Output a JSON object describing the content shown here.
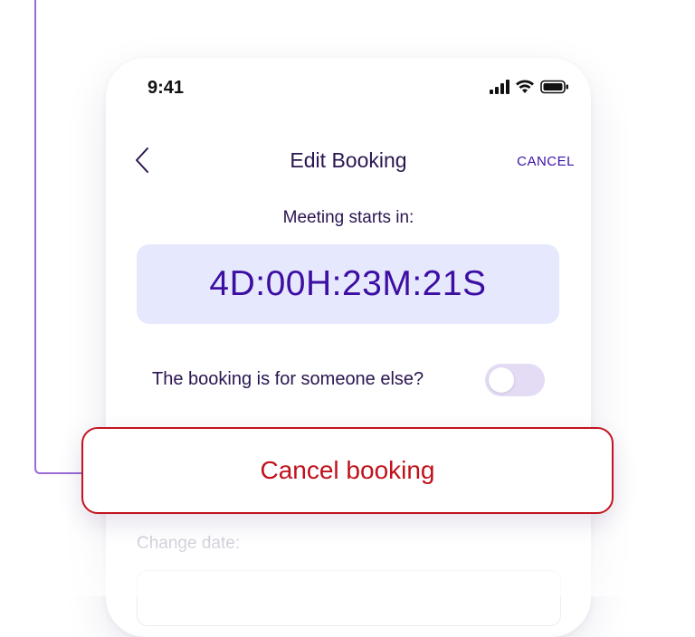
{
  "status_bar": {
    "time": "9:41",
    "icons": [
      "signal-icon",
      "wifi-icon",
      "battery-icon"
    ]
  },
  "nav": {
    "back_icon": "chevron-left-icon",
    "title": "Edit Booking",
    "cancel_label": "CANCEL"
  },
  "countdown": {
    "label": "Meeting starts in:",
    "value": "4D:00H:23M:21S"
  },
  "booking_for_other": {
    "label": "The booking is for someone else?",
    "enabled": false
  },
  "cancel_button": {
    "label": "Cancel booking"
  },
  "change_date": {
    "label": "Change date:"
  },
  "colors": {
    "accent": "#3d0ea2",
    "countdown_bg": "#e6e9fd",
    "danger": "#c0111c",
    "connector": "#9a6bd6",
    "toggle_off": "#e4dcf5"
  }
}
